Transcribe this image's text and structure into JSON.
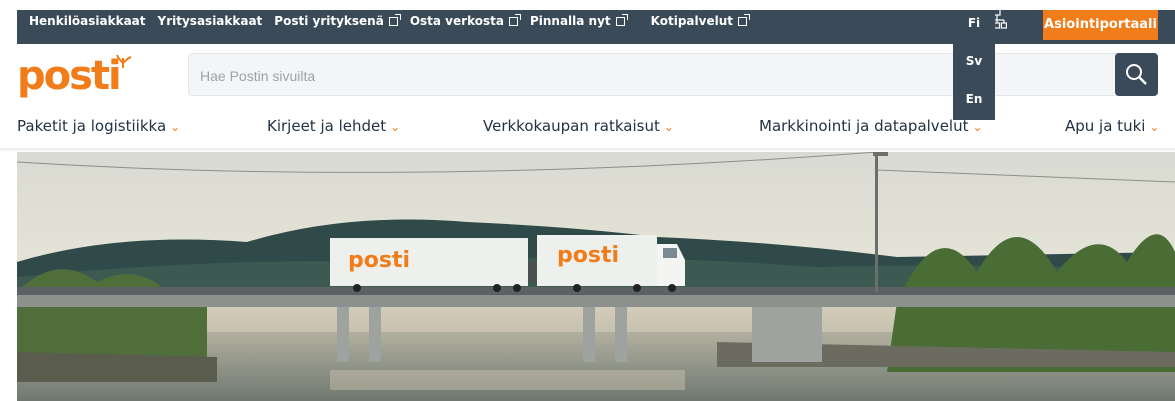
{
  "topbar": {
    "links": [
      {
        "label": "Henkilöasiakkaat",
        "external": false
      },
      {
        "label": "Yritysasiakkaat",
        "external": false
      },
      {
        "label": "Posti yrityksenä",
        "external": true
      },
      {
        "label": "Osta verkosta",
        "external": true
      },
      {
        "label": "Pinnalla nyt",
        "external": true
      },
      {
        "label": "Kotipalvelut",
        "external": true
      }
    ],
    "portal_button": "Asiointiportaali",
    "sitemap_icon": "sitemap-icon"
  },
  "language": {
    "options": [
      "Fi",
      "Sv",
      "En"
    ]
  },
  "logo": {
    "text": "posti"
  },
  "search": {
    "placeholder": "Hae Postin sivuilta",
    "value": "",
    "button_icon": "search-icon"
  },
  "nav": {
    "items": [
      {
        "label": "Paketit ja logistiikka"
      },
      {
        "label": "Kirjeet ja lehdet"
      },
      {
        "label": "Verkkokaupan ratkaisut"
      },
      {
        "label": "Markkinointi ja datapalvelut"
      },
      {
        "label": "Apu ja tuki"
      }
    ]
  },
  "hero": {
    "truck_logo_front": "posti",
    "truck_logo_trailer": "posti",
    "image_icon": "truck-on-bridge-photo"
  },
  "colors": {
    "brand_orange": "#f07d1a",
    "dark_bar": "#3b4a58"
  }
}
